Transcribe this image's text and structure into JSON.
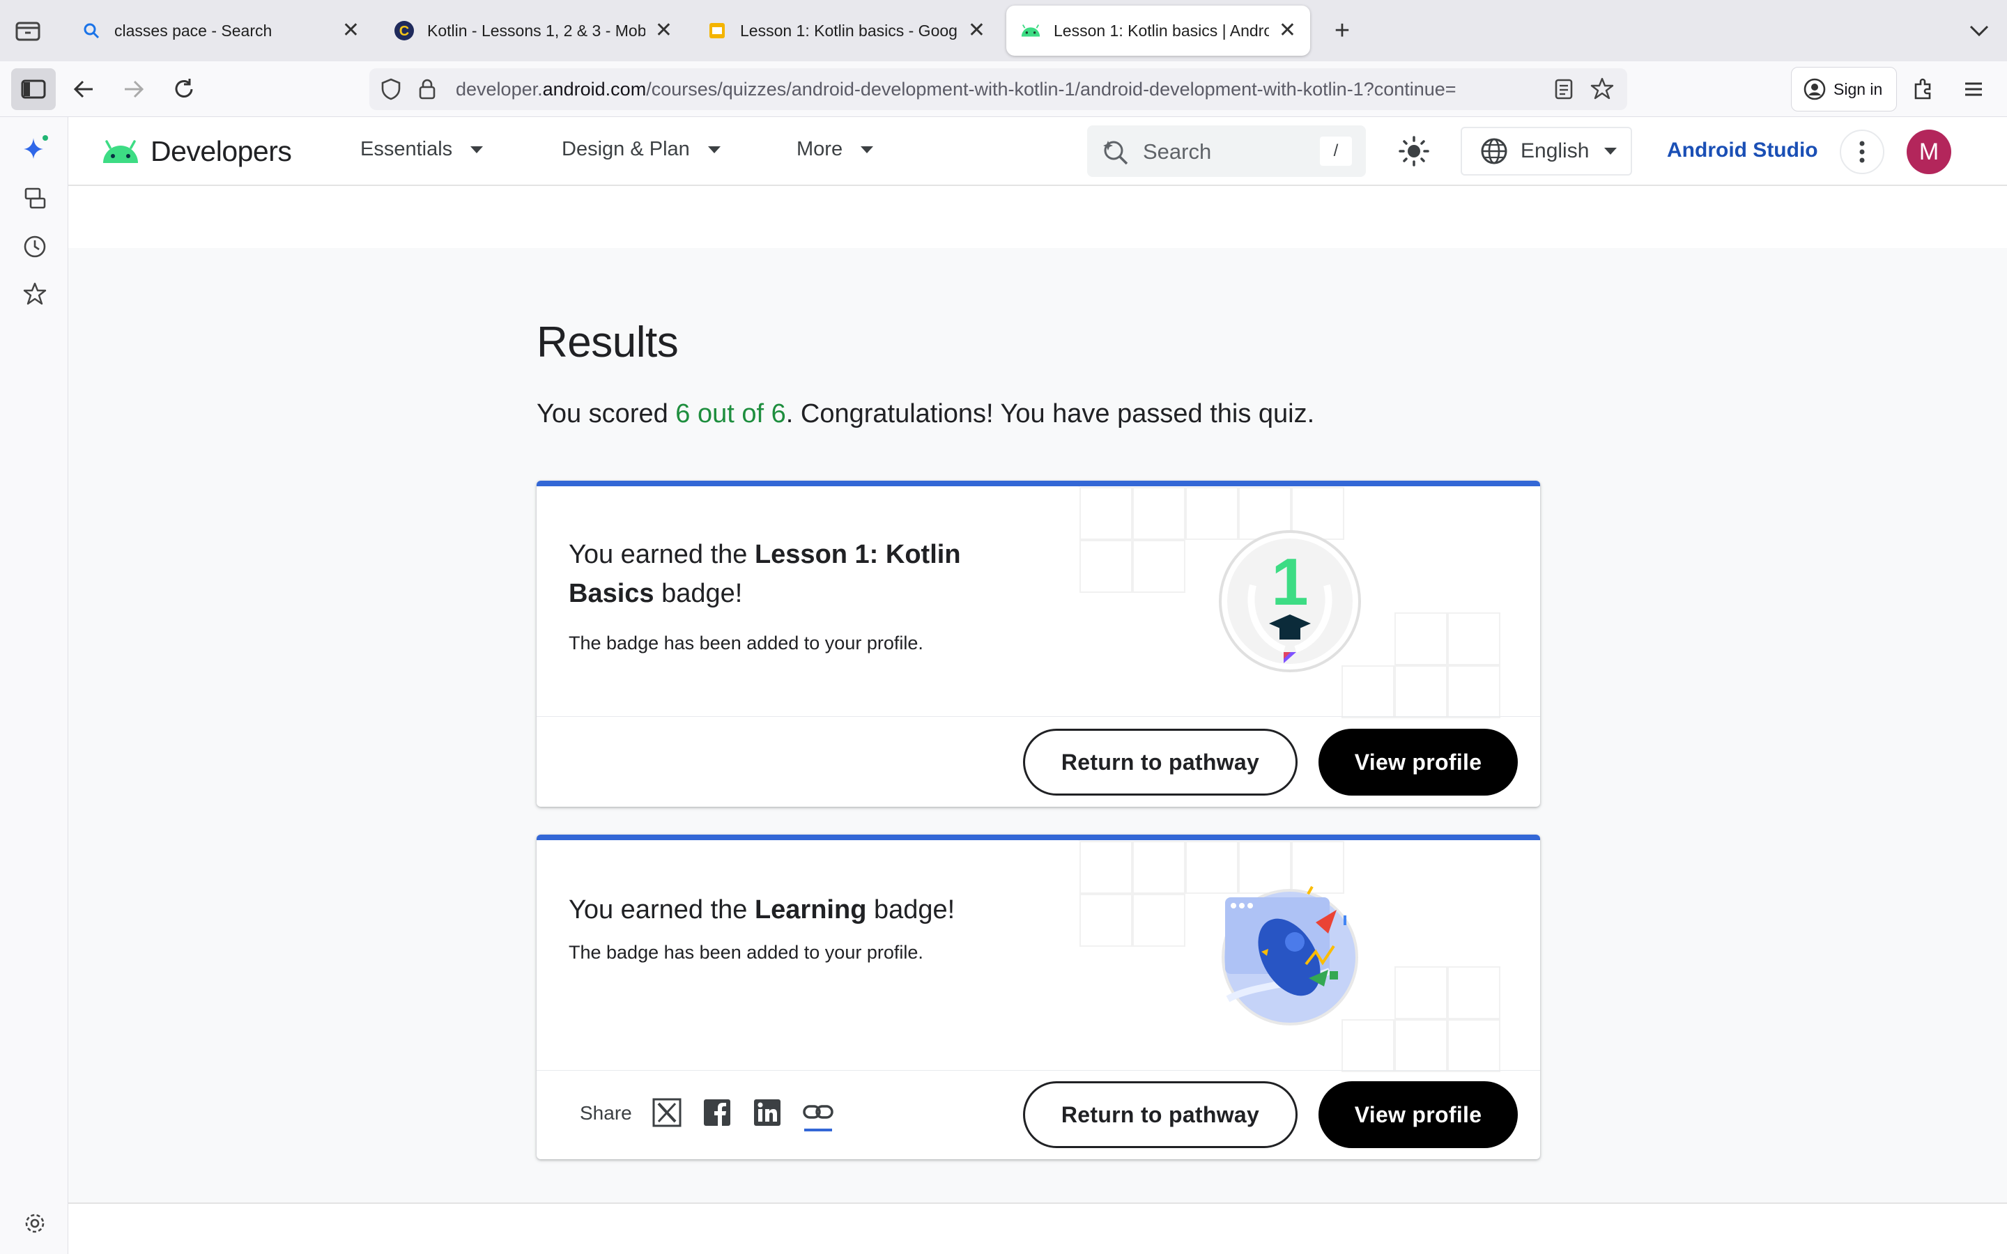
{
  "browser": {
    "tabs": [
      {
        "title": "classes pace - Search",
        "active": false
      },
      {
        "title": "Kotlin - Lessons 1, 2 & 3 - Mobil",
        "active": false
      },
      {
        "title": "Lesson 1: Kotlin basics - Google",
        "active": false
      },
      {
        "title": "Lesson 1: Kotlin basics  |  Androi",
        "active": true
      }
    ],
    "url_domain_prefix": "developer.",
    "url_domain": "android.com",
    "url_path": "/courses/quizzes/android-development-with-kotlin-1/android-development-with-kotlin-1?continue=",
    "signin_label": "Sign in"
  },
  "site": {
    "logo_text": "Developers",
    "nav": [
      "Essentials",
      "Design & Plan",
      "More"
    ],
    "search_placeholder": "Search",
    "search_shortcut": "/",
    "language": "English",
    "studio_link": "Android Studio",
    "avatar_letter": "M"
  },
  "results": {
    "heading": "Results",
    "score_prefix": "You scored ",
    "score_value": "6 out of 6",
    "score_suffix": ". Congratulations! You have passed this quiz."
  },
  "cards": [
    {
      "title_prefix": "You earned the ",
      "title_bold": "Lesson 1: Kotlin Basics",
      "title_suffix": " badge!",
      "description": "The badge has been added to your profile.",
      "badge_number": "1",
      "return_label": "Return to pathway",
      "profile_label": "View profile"
    },
    {
      "title_prefix": "You earned the ",
      "title_bold": "Learning",
      "title_suffix": " badge!",
      "description": "The badge has been added to your profile.",
      "share_label": "Share",
      "return_label": "Return to pathway",
      "profile_label": "View profile"
    }
  ],
  "colors": {
    "accent_blue": "#3367d6",
    "score_green": "#1e8e3e",
    "android_green": "#3ddc84",
    "avatar_bg": "#b3265b",
    "studio_link": "#1a4fb5"
  }
}
